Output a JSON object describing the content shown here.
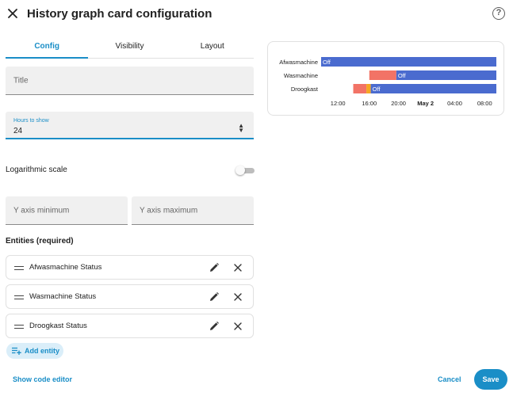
{
  "header": {
    "title": "History graph card configuration",
    "close_icon": "close-icon",
    "help_icon": "help-circle-icon",
    "help_glyph": "?"
  },
  "tabs": [
    {
      "label": "Config",
      "active": true
    },
    {
      "label": "Visibility",
      "active": false
    },
    {
      "label": "Layout",
      "active": false
    }
  ],
  "form": {
    "title_placeholder": "Title",
    "hours_label": "Hours to show",
    "hours_value": "24",
    "log_scale_label": "Logarithmic scale",
    "log_scale_on": false,
    "y_min_placeholder": "Y axis minimum",
    "y_max_placeholder": "Y axis maximum"
  },
  "entities": {
    "heading": "Entities (required)",
    "items": [
      {
        "name": "Afwasmachine Status"
      },
      {
        "name": "Wasmachine Status"
      },
      {
        "name": "Droogkast Status"
      }
    ],
    "add_label": "Add entity"
  },
  "footer": {
    "show_code_label": "Show code editor",
    "cancel_label": "Cancel",
    "save_label": "Save"
  },
  "colors": {
    "accent": "#1a8ec7",
    "state_off": "#4a6bcf",
    "state_on": "#f27366",
    "state_other": "#f5a623"
  },
  "chart_data": {
    "type": "timeline",
    "rows": [
      "Afwasmachine",
      "Wasmachine",
      "Droogkast"
    ],
    "ticks": [
      {
        "label": "12:00",
        "bold": false
      },
      {
        "label": "16:00",
        "bold": false
      },
      {
        "label": "20:00",
        "bold": false
      },
      {
        "label": "May 2",
        "bold": true
      },
      {
        "label": "04:00",
        "bold": false
      },
      {
        "label": "08:00",
        "bold": false
      }
    ],
    "x_range_hours": [
      0,
      24
    ],
    "tick_hours": [
      2.3,
      6.6,
      10.6,
      14.3,
      18.3,
      22.4
    ],
    "segments": [
      {
        "row": 0,
        "start": 0,
        "end": 24,
        "state": "off",
        "label": "Off"
      },
      {
        "row": 1,
        "start": 6.6,
        "end": 10.3,
        "state": "on",
        "label": ""
      },
      {
        "row": 1,
        "start": 10.3,
        "end": 24,
        "state": "off",
        "label": "Off"
      },
      {
        "row": 2,
        "start": 4.4,
        "end": 6.2,
        "state": "on",
        "label": ""
      },
      {
        "row": 2,
        "start": 6.2,
        "end": 6.8,
        "state": "other",
        "label": ""
      },
      {
        "row": 2,
        "start": 6.8,
        "end": 24,
        "state": "off",
        "label": "Off"
      }
    ]
  }
}
